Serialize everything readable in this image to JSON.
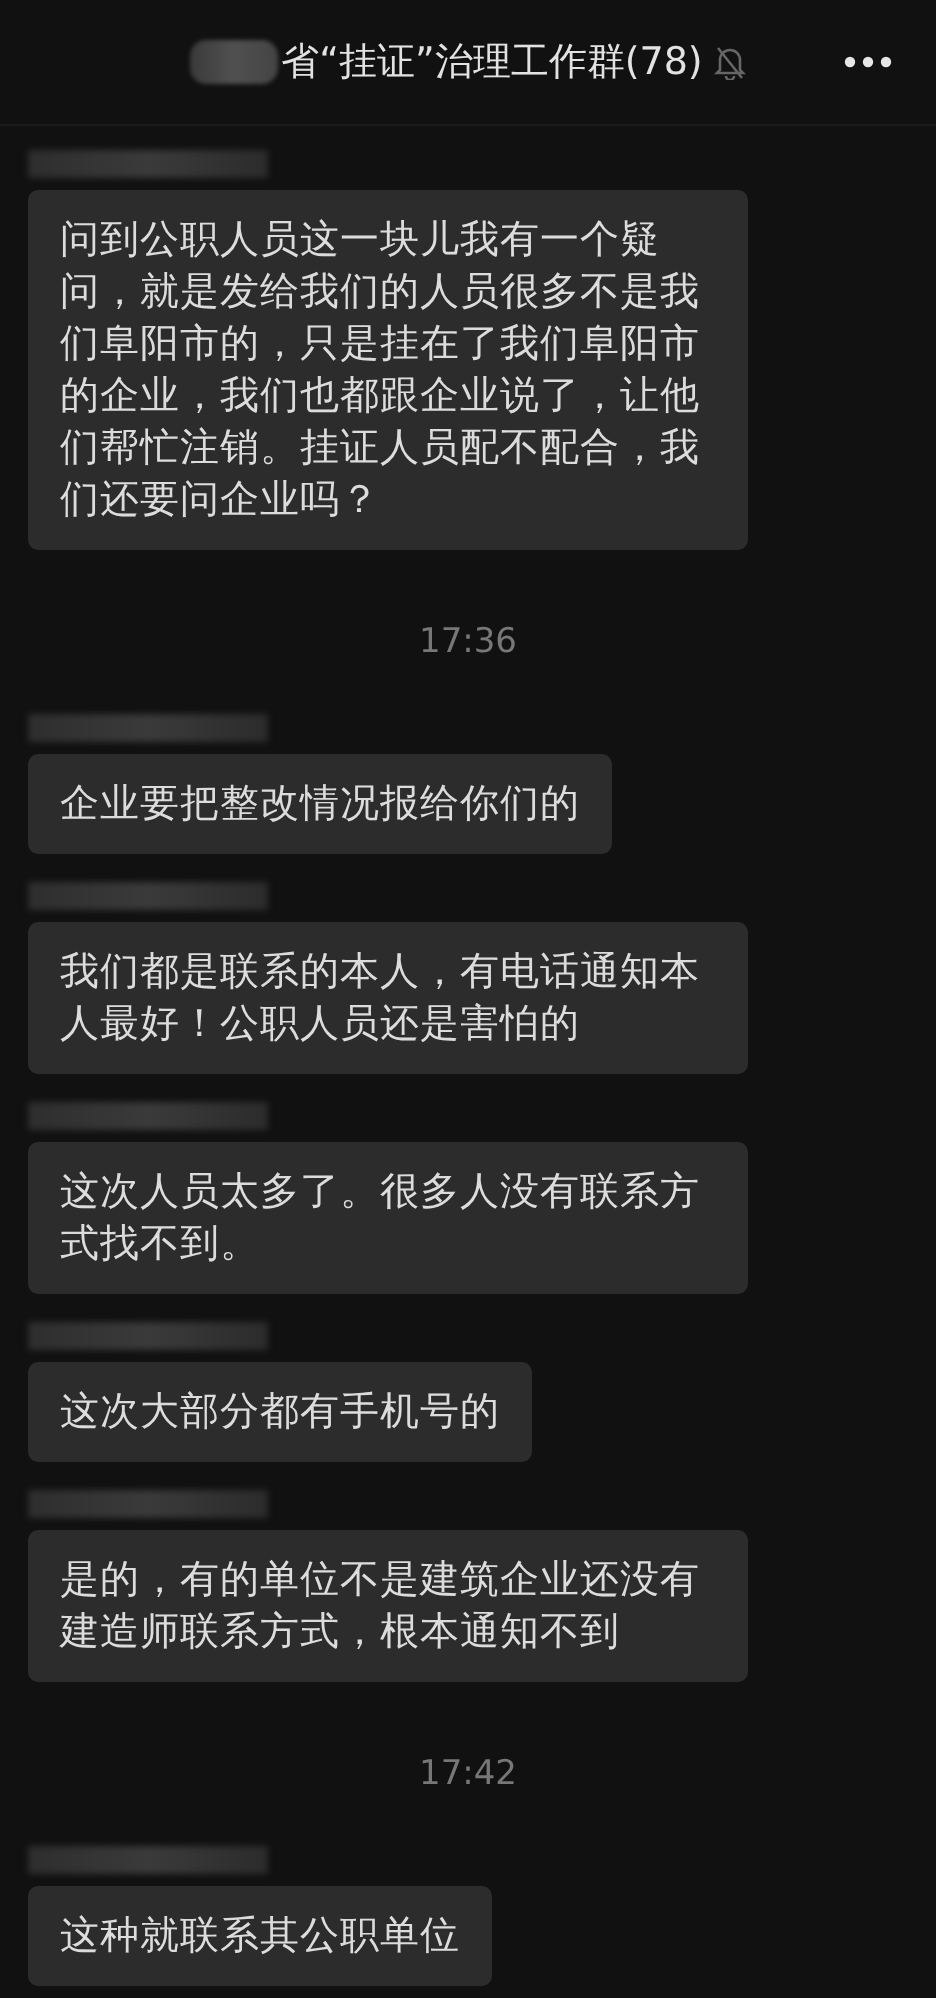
{
  "header": {
    "title": "省“挂证”治理工作群(78)",
    "muted": true
  },
  "messages": [
    {
      "kind": "message",
      "text": "问到公职人员这一块儿我有一个疑问，就是发给我们的人员很多不是我们阜阳市的，只是挂在了我们阜阳市的企业，我们也都跟企业说了，让他们帮忙注销。挂证人员配不配合，我们还要问企业吗？"
    },
    {
      "kind": "time",
      "text": "17:36"
    },
    {
      "kind": "message",
      "text": "企业要把整改情况报给你们的"
    },
    {
      "kind": "message",
      "text": "我们都是联系的本人，有电话通知本人最好！公职人员还是害怕的"
    },
    {
      "kind": "message",
      "text": "这次人员太多了。很多人没有联系方式找不到。"
    },
    {
      "kind": "message",
      "text": "这次大部分都有手机号的"
    },
    {
      "kind": "message",
      "text": "是的，有的单位不是建筑企业还没有建造师联系方式，根本通知不到"
    },
    {
      "kind": "time",
      "text": "17:42"
    },
    {
      "kind": "message",
      "text": "这种就联系其公职单位"
    }
  ]
}
